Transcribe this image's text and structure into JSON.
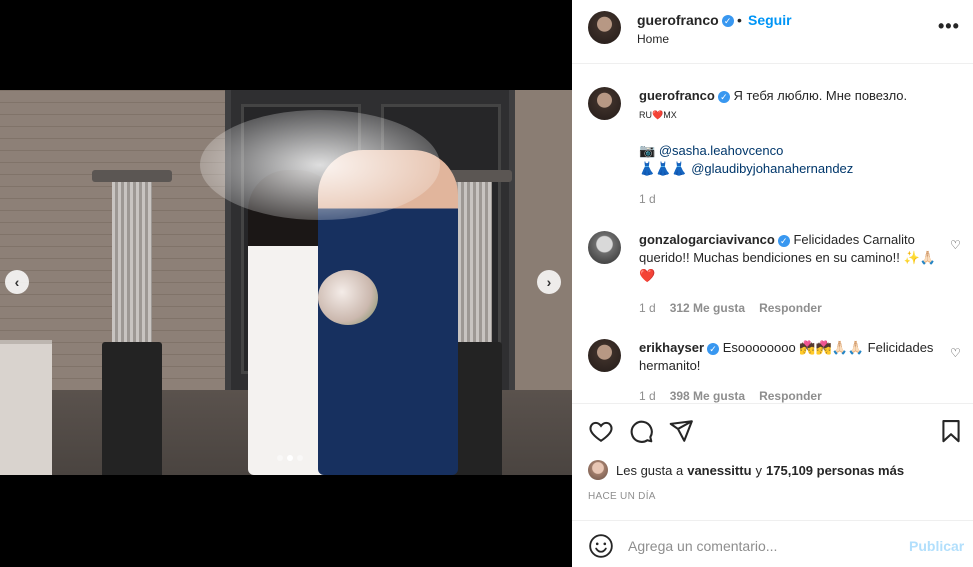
{
  "post": {
    "author": "guerofranco",
    "follow_label": "Seguir",
    "separator": "•",
    "location": "Home",
    "more_label": "•••",
    "carousel": {
      "slide_count": 3,
      "active_slide": 2,
      "prev_label": "‹",
      "next_label": "›"
    }
  },
  "caption": {
    "username": "guerofranco",
    "text": "Я тебя люблю. Мне повезло.",
    "flags": "RU❤️MX",
    "line1_icon": "📷",
    "mention1": "@sasha.leahovcenco",
    "line2_icons": "👗👗👗",
    "mention2": "@glaudibyjohanahernandez",
    "time": "1 d"
  },
  "comments": [
    {
      "username": "gonzalogarciavivanco",
      "text": "Felicidades Carnalito querido!! Muchas bendiciones en su camino!! ✨🙏🏻❤️",
      "time": "1 d",
      "likes": "312 Me gusta",
      "reply_label": "Responder"
    },
    {
      "username": "erikhayser",
      "text": "Esoooooooo 💏💏🙏🏻🙏🏻 Felicidades hermanito!",
      "time": "1 d",
      "likes": "398 Me gusta",
      "reply_label": "Responder"
    }
  ],
  "likes": {
    "prefix": "Les gusta a",
    "user": "vanessittu",
    "connector": "y",
    "count": "175,109 personas más"
  },
  "timestamp": "HACE UN DÍA",
  "comment_box": {
    "placeholder": "Agrega un comentario...",
    "publish_label": "Publicar"
  },
  "colors": {
    "accent": "#0095f6",
    "verified": "#3897f0",
    "muted": "#8e8e8e",
    "publish_disabled": "#b2dffc"
  }
}
